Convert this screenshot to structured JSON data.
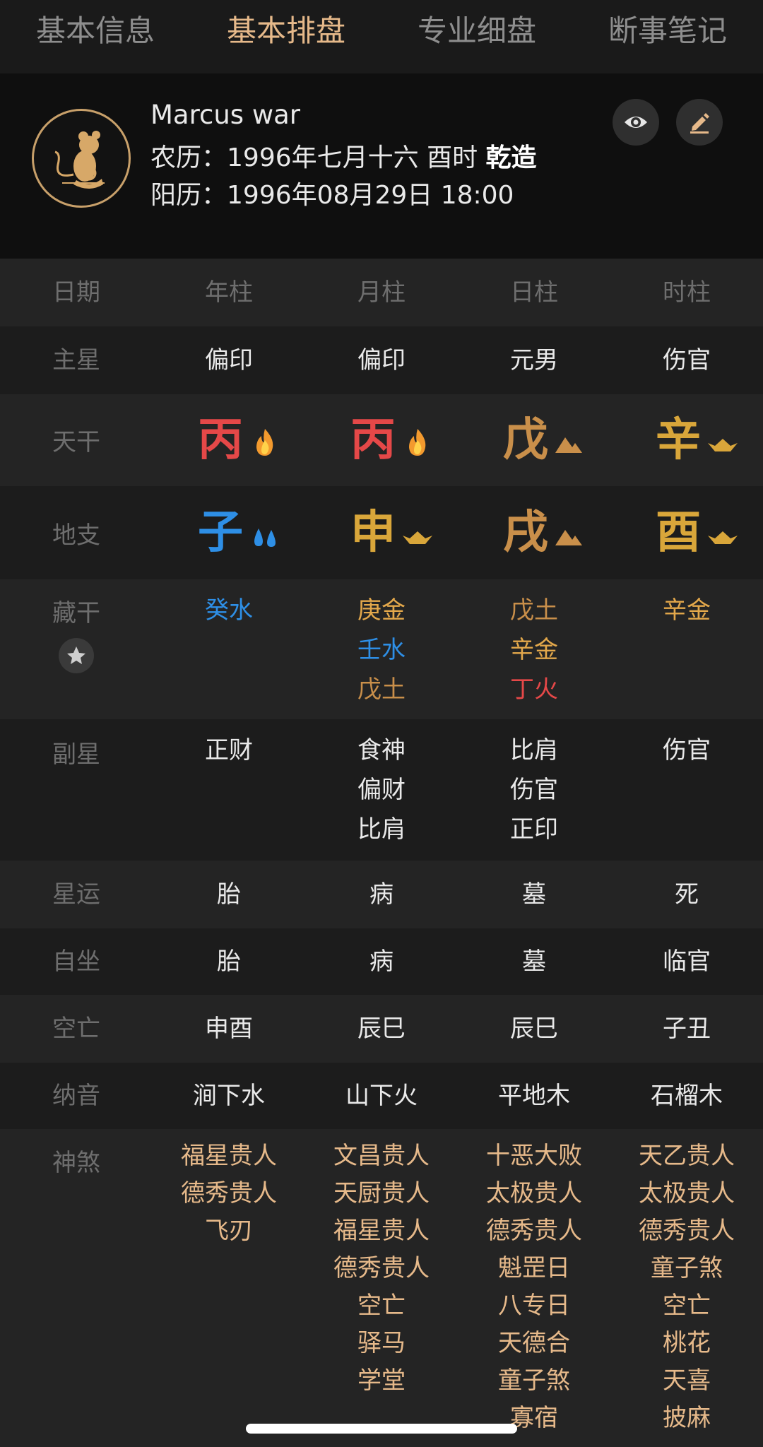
{
  "tabs": [
    "基本信息",
    "基本排盘",
    "专业细盘",
    "断事笔记"
  ],
  "profile": {
    "name": "Marcus war",
    "lunar_label": "农历：",
    "lunar_value": "1996年七月十六 酉时",
    "gender": "乾造",
    "solar_label": "阳历：",
    "solar_value": "1996年08月29日 18:00",
    "avatar_icon": "rat-zodiac-icon"
  },
  "table": {
    "header": {
      "label": "日期",
      "cols": [
        "年柱",
        "月柱",
        "日柱",
        "时柱"
      ]
    },
    "main_star": {
      "label": "主星",
      "cols": [
        "偏印",
        "偏印",
        "元男",
        "伤官"
      ]
    },
    "tiangan": {
      "label": "天干",
      "cols": [
        {
          "char": "丙",
          "element": "fire"
        },
        {
          "char": "丙",
          "element": "fire"
        },
        {
          "char": "戊",
          "element": "earth"
        },
        {
          "char": "辛",
          "element": "metal"
        }
      ]
    },
    "dizhi": {
      "label": "地支",
      "cols": [
        {
          "char": "子",
          "element": "water"
        },
        {
          "char": "申",
          "element": "metal"
        },
        {
          "char": "戌",
          "element": "earth"
        },
        {
          "char": "酉",
          "element": "metal"
        }
      ]
    },
    "canggan": {
      "label": "藏干",
      "cols": [
        [
          "癸水"
        ],
        [
          "庚金",
          "壬水",
          "戊土"
        ],
        [
          "戊土",
          "辛金",
          "丁火"
        ],
        [
          "辛金"
        ]
      ]
    },
    "fuxing": {
      "label": "副星",
      "cols": [
        [
          "正财"
        ],
        [
          "食神",
          "偏财",
          "比肩"
        ],
        [
          "比肩",
          "伤官",
          "正印"
        ],
        [
          "伤官"
        ]
      ]
    },
    "xingyun": {
      "label": "星运",
      "cols": [
        "胎",
        "病",
        "墓",
        "死"
      ]
    },
    "zizuo": {
      "label": "自坐",
      "cols": [
        "胎",
        "病",
        "墓",
        "临官"
      ]
    },
    "kongwang": {
      "label": "空亡",
      "cols": [
        "申酉",
        "辰巳",
        "辰巳",
        "子丑"
      ]
    },
    "nayin": {
      "label": "纳音",
      "cols": [
        "涧下水",
        "山下火",
        "平地木",
        "石榴木"
      ]
    },
    "shensha": {
      "label": "神煞",
      "cols": [
        [
          "福星贵人",
          "德秀贵人",
          "飞刃"
        ],
        [
          "文昌贵人",
          "天厨贵人",
          "福星贵人",
          "德秀贵人",
          "空亡",
          "驿马",
          "学堂"
        ],
        [
          "十恶大败",
          "太极贵人",
          "德秀贵人",
          "魁罡日",
          "八专日",
          "天德合",
          "童子煞",
          "寡宿"
        ],
        [
          "天乙贵人",
          "太极贵人",
          "德秀贵人",
          "童子煞",
          "空亡",
          "桃花",
          "天喜",
          "披麻"
        ]
      ]
    }
  },
  "colors": {
    "accent": "#e6b98a",
    "fire": "#e54848",
    "earth": "#c98f4a",
    "metal": "#d9a63a",
    "water": "#2e8fe6"
  }
}
